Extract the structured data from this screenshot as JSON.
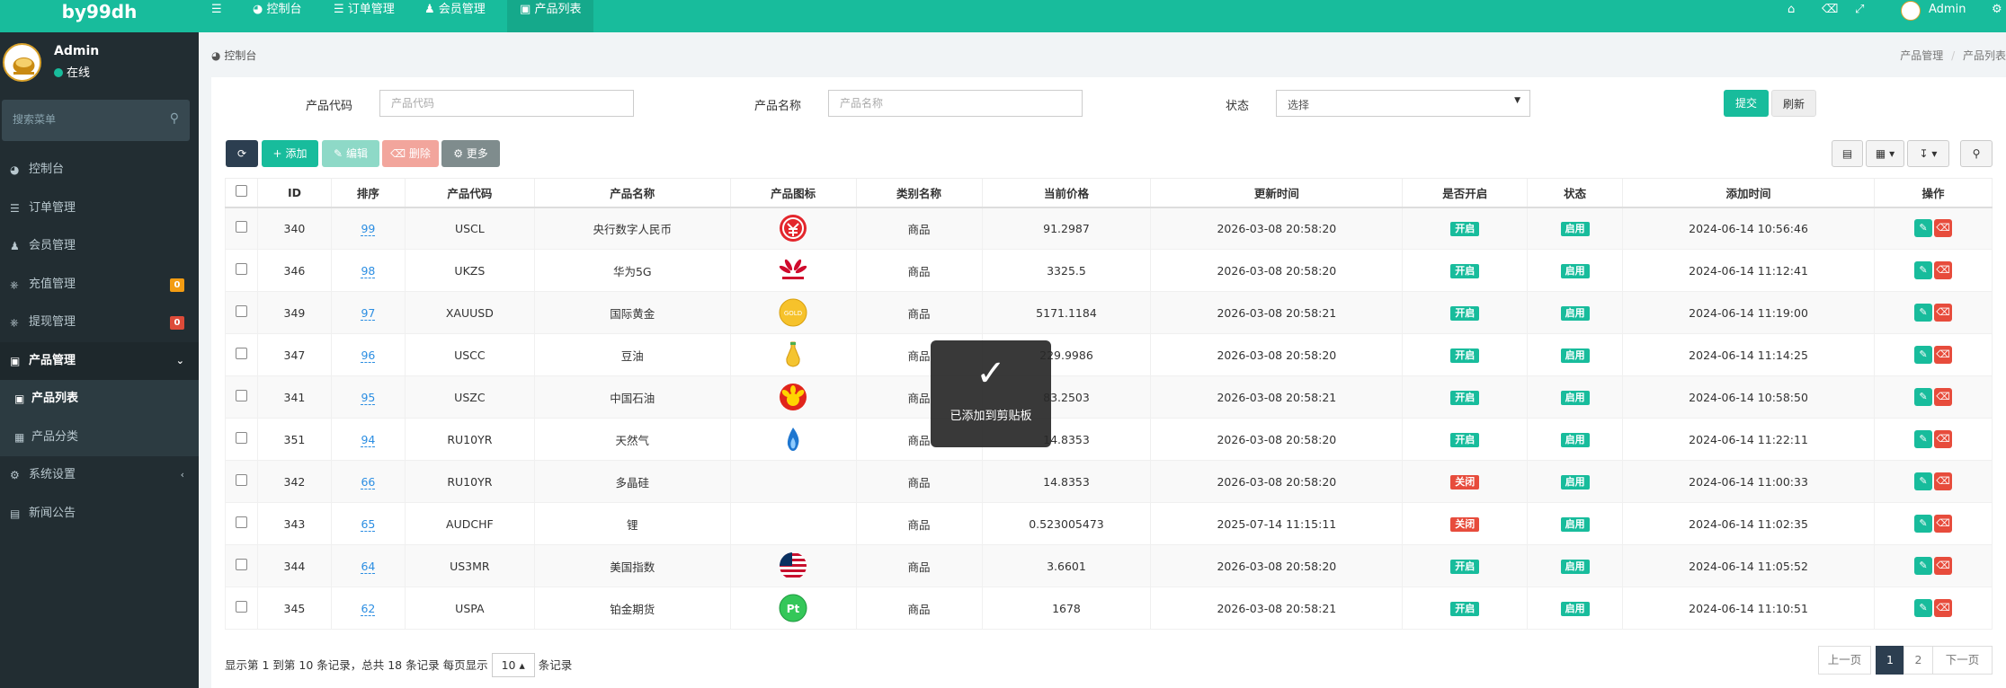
{
  "brand": "by99dh",
  "user": {
    "name": "Admin",
    "status": "在线"
  },
  "sidebar": {
    "search_placeholder": "搜索菜单",
    "items": [
      {
        "label": "控制台",
        "icon": "dashboard-icon"
      },
      {
        "label": "订单管理",
        "icon": "list-icon"
      },
      {
        "label": "会员管理",
        "icon": "users-icon"
      },
      {
        "label": "充值管理",
        "icon": "recharge-icon",
        "badge": "0",
        "badge_color": "#f39c12"
      },
      {
        "label": "提现管理",
        "icon": "withdraw-icon",
        "badge": "0",
        "badge_color": "#dd4b39"
      },
      {
        "label": "产品管理",
        "icon": "shopping-bag-icon"
      },
      {
        "label": "产品列表",
        "icon": "shopping-bag-icon"
      },
      {
        "label": "产品分类",
        "icon": "table-icon"
      },
      {
        "label": "系统设置",
        "icon": "cogs-icon"
      },
      {
        "label": "新闻公告",
        "icon": "newspaper-icon"
      }
    ]
  },
  "topnav": {
    "tabs": [
      {
        "label": "控制台"
      },
      {
        "label": "订单管理"
      },
      {
        "label": "会员管理"
      },
      {
        "label": "产品列表"
      }
    ],
    "admin_label": "Admin"
  },
  "breadcrumb": {
    "home": "控制台",
    "path_1": "产品管理",
    "sep": "/",
    "path_2": "产品列表"
  },
  "filters": {
    "code_label": "产品代码",
    "code_placeholder": "产品代码",
    "name_label": "产品名称",
    "name_placeholder": "产品名称",
    "status_label": "状态",
    "status_value": "选择",
    "submit": "提交",
    "reset": "刷新"
  },
  "toolbar": {
    "add": "添加",
    "edit": "编辑",
    "delete": "删除",
    "more": "更多"
  },
  "table": {
    "headers": [
      "ID",
      "排序",
      "产品代码",
      "产品名称",
      "产品图标",
      "类别名称",
      "当前价格",
      "更新时间",
      "是否开启",
      "状态",
      "添加时间",
      "操作"
    ],
    "rows": [
      {
        "id": "340",
        "sort": "99",
        "code": "USCL",
        "name": "央行数字人民币",
        "icon": "digital-yuan-icon",
        "category": "商品",
        "price": "91.2987",
        "updated": "2026-03-08 20:58:20",
        "open": "开启",
        "status": "启用",
        "added": "2024-06-14 10:56:46"
      },
      {
        "id": "346",
        "sort": "98",
        "code": "UKZS",
        "name": "华为5G",
        "icon": "huawei-icon",
        "category": "商品",
        "price": "3325.5",
        "updated": "2026-03-08 20:58:20",
        "open": "开启",
        "status": "启用",
        "added": "2024-06-14 11:12:41"
      },
      {
        "id": "349",
        "sort": "97",
        "code": "XAUUSD",
        "name": "国际黄金",
        "icon": "gold-icon",
        "category": "商品",
        "price": "5171.1184",
        "updated": "2026-03-08 20:58:21",
        "open": "开启",
        "status": "启用",
        "added": "2024-06-14 11:19:00"
      },
      {
        "id": "347",
        "sort": "96",
        "code": "USCC",
        "name": "豆油",
        "icon": "oil-bottle-icon",
        "category": "商品",
        "price": "229.9986",
        "updated": "2026-03-08 20:58:20",
        "open": "开启",
        "status": "启用",
        "added": "2024-06-14 11:14:25"
      },
      {
        "id": "341",
        "sort": "95",
        "code": "USZC",
        "name": "中国石油",
        "icon": "petrochina-icon",
        "category": "商品",
        "price": "83.2503",
        "updated": "2026-03-08 20:58:21",
        "open": "开启",
        "status": "启用",
        "added": "2024-06-14 10:58:50"
      },
      {
        "id": "351",
        "sort": "94",
        "code": "RU10YR",
        "name": "天然气",
        "icon": "flame-icon",
        "category": "商品",
        "price": "14.8353",
        "updated": "2026-03-08 20:58:20",
        "open": "开启",
        "status": "启用",
        "added": "2024-06-14 11:22:11"
      },
      {
        "id": "342",
        "sort": "66",
        "code": "RU10YR",
        "name": "多晶硅",
        "icon": "",
        "category": "商品",
        "price": "14.8353",
        "updated": "2026-03-08 20:58:20",
        "open": "关闭",
        "status": "启用",
        "added": "2024-06-14 11:00:33"
      },
      {
        "id": "343",
        "sort": "65",
        "code": "AUDCHF",
        "name": "锂",
        "icon": "",
        "category": "商品",
        "price": "0.523005473",
        "updated": "2025-07-14 11:15:11",
        "open": "关闭",
        "status": "启用",
        "added": "2024-06-14 11:02:35"
      },
      {
        "id": "344",
        "sort": "64",
        "code": "US3MR",
        "name": "美国指数",
        "icon": "us-flag-icon",
        "category": "商品",
        "price": "3.6601",
        "updated": "2026-03-08 20:58:20",
        "open": "开启",
        "status": "启用",
        "added": "2024-06-14 11:05:52"
      },
      {
        "id": "345",
        "sort": "62",
        "code": "USPA",
        "name": "铂金期货",
        "icon": "platinum-icon",
        "category": "商品",
        "price": "1678",
        "updated": "2026-03-08 20:58:21",
        "open": "开启",
        "status": "启用",
        "added": "2024-06-14 11:10:51"
      }
    ]
  },
  "footer": {
    "summary_a": "显示第 1 到第 10 条记录，总共 18 条记录 每页显示",
    "page_size": "10",
    "summary_b": "条记录"
  },
  "pagination": {
    "prev": "上一页",
    "pages": [
      "1",
      "2"
    ],
    "next": "下一页",
    "current": "1"
  },
  "toast": {
    "message": "已添加到剪贴板"
  },
  "colors": {
    "accent": "#18bc9c",
    "sidebar": "#222d32",
    "danger": "#e74c3c",
    "primary_dark": "#2c3e50",
    "info": "#2c8ee2"
  }
}
